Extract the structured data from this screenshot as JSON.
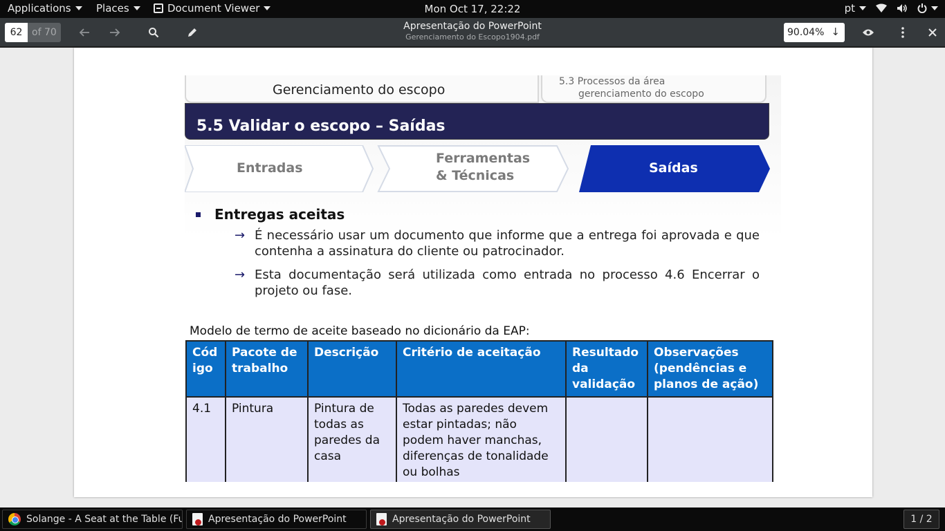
{
  "topbar": {
    "applications": "Applications",
    "places": "Places",
    "app_name": "Document Viewer",
    "clock": "Mon Oct 17, 22:22",
    "language": "pt",
    "icons": [
      "wifi-icon",
      "volume-icon",
      "power-icon"
    ]
  },
  "viewer": {
    "page_current": "62",
    "page_total": "of 70",
    "title": "Apresentação do PowerPoint",
    "filename": "Gerenciamento do Escopo1904.pdf",
    "zoom": "90.04%"
  },
  "slide": {
    "tab_left": "Gerenciamento do escopo",
    "tab_right_line1": "5.3  Processos da área",
    "tab_right_line2": "gerenciamento do escopo",
    "banner": "5.5 Validar o escopo – Saídas",
    "steps": [
      {
        "line1": "Entradas",
        "line2": ""
      },
      {
        "line1": "Ferramentas",
        "line2": "& Técnicas"
      },
      {
        "line1": "Saídas",
        "line2": ""
      }
    ],
    "bullet_title": "Entregas aceitas",
    "arrow": "→",
    "subpoints": [
      "É necessário usar um documento que informe que a entrega foi aprovada e que contenha a assinatura do cliente ou patrocinador.",
      "Esta documentação será utilizada como entrada no processo 4.6 Encerrar o projeto ou fase."
    ],
    "caption": "Modelo de termo de aceite baseado no dicionário da EAP:",
    "table": {
      "headers": [
        "Cód igo",
        "Pacote de trabalho",
        "Descrição",
        "Critério de aceitação",
        "Resultado da validação",
        "Observações (pendências e planos de ação)"
      ],
      "row": [
        "4.1",
        "Pintura",
        "Pintura de todas as paredes da casa",
        "Todas as paredes devem estar pintadas; não podem haver manchas, diferenças de tonalidade ou bolhas",
        "",
        ""
      ]
    }
  },
  "taskbar": {
    "items": [
      "Solange - A Seat at the Table (Ful...",
      "Apresentação do PowerPoint",
      "Apresentação do PowerPoint"
    ],
    "pager": "1 / 2"
  }
}
